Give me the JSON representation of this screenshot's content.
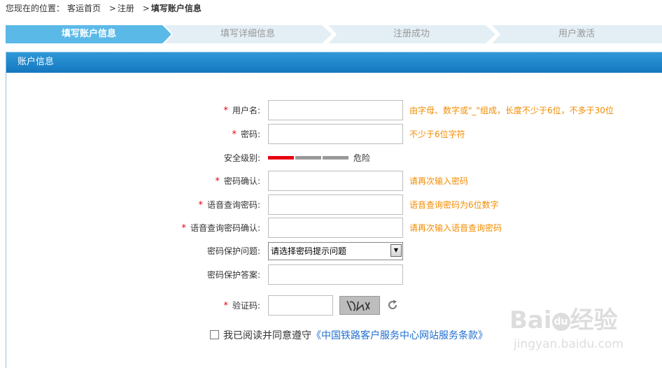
{
  "breadcrumb": {
    "prefix": "您现在的位置：",
    "items": [
      "客运首页",
      "注册",
      "填写账户信息"
    ]
  },
  "steps": [
    {
      "label": "填写账户信息",
      "active": true
    },
    {
      "label": "填写详细信息",
      "active": false
    },
    {
      "label": "注册成功",
      "active": false
    },
    {
      "label": "用户激活",
      "active": false
    }
  ],
  "panel": {
    "title": "账户信息"
  },
  "form": {
    "username": {
      "label": "用户名:",
      "required": true,
      "value": "",
      "hint": "由字母、数字或\"_\"组成，长度不少于6位，不多于30位"
    },
    "password": {
      "label": "密码:",
      "required": true,
      "value": "",
      "hint": "不少于6位字符"
    },
    "security_level": {
      "label": "安全级别:",
      "level_text": "危险",
      "level_fraction": 0.33
    },
    "password_confirm": {
      "label": "密码确认:",
      "required": true,
      "value": "",
      "hint": "请再次输入密码"
    },
    "voice_password": {
      "label": "语音查询密码:",
      "required": true,
      "value": "",
      "hint": "语音查询密码为6位数字"
    },
    "voice_password_confirm": {
      "label": "语音查询密码确认:",
      "required": true,
      "value": "",
      "hint": "请再次输入语音查询密码"
    },
    "security_question": {
      "label": "密码保护问题:",
      "required": false,
      "selected": "请选择密码提示问题"
    },
    "security_answer": {
      "label": "密码保护答案:",
      "required": false,
      "value": ""
    },
    "captcha": {
      "label": "验证码:",
      "required": true,
      "value": ""
    }
  },
  "agreement": {
    "text": "我已阅读并同意遵守",
    "link": "《中国铁路客户服务中心网站服务条款》"
  },
  "colors": {
    "active_step": "#5bb9e8",
    "inactive_step": "#e3eef5",
    "panel_header": "#1a80c8",
    "required_star": "#e60012",
    "hint_text": "#f28c00",
    "strength_weak": "#e60012",
    "strength_empty": "#999999",
    "link": "#1f6fd1"
  },
  "watermark": {
    "line1": "Baidu经验",
    "line2": "jingyan.baidu.com"
  }
}
